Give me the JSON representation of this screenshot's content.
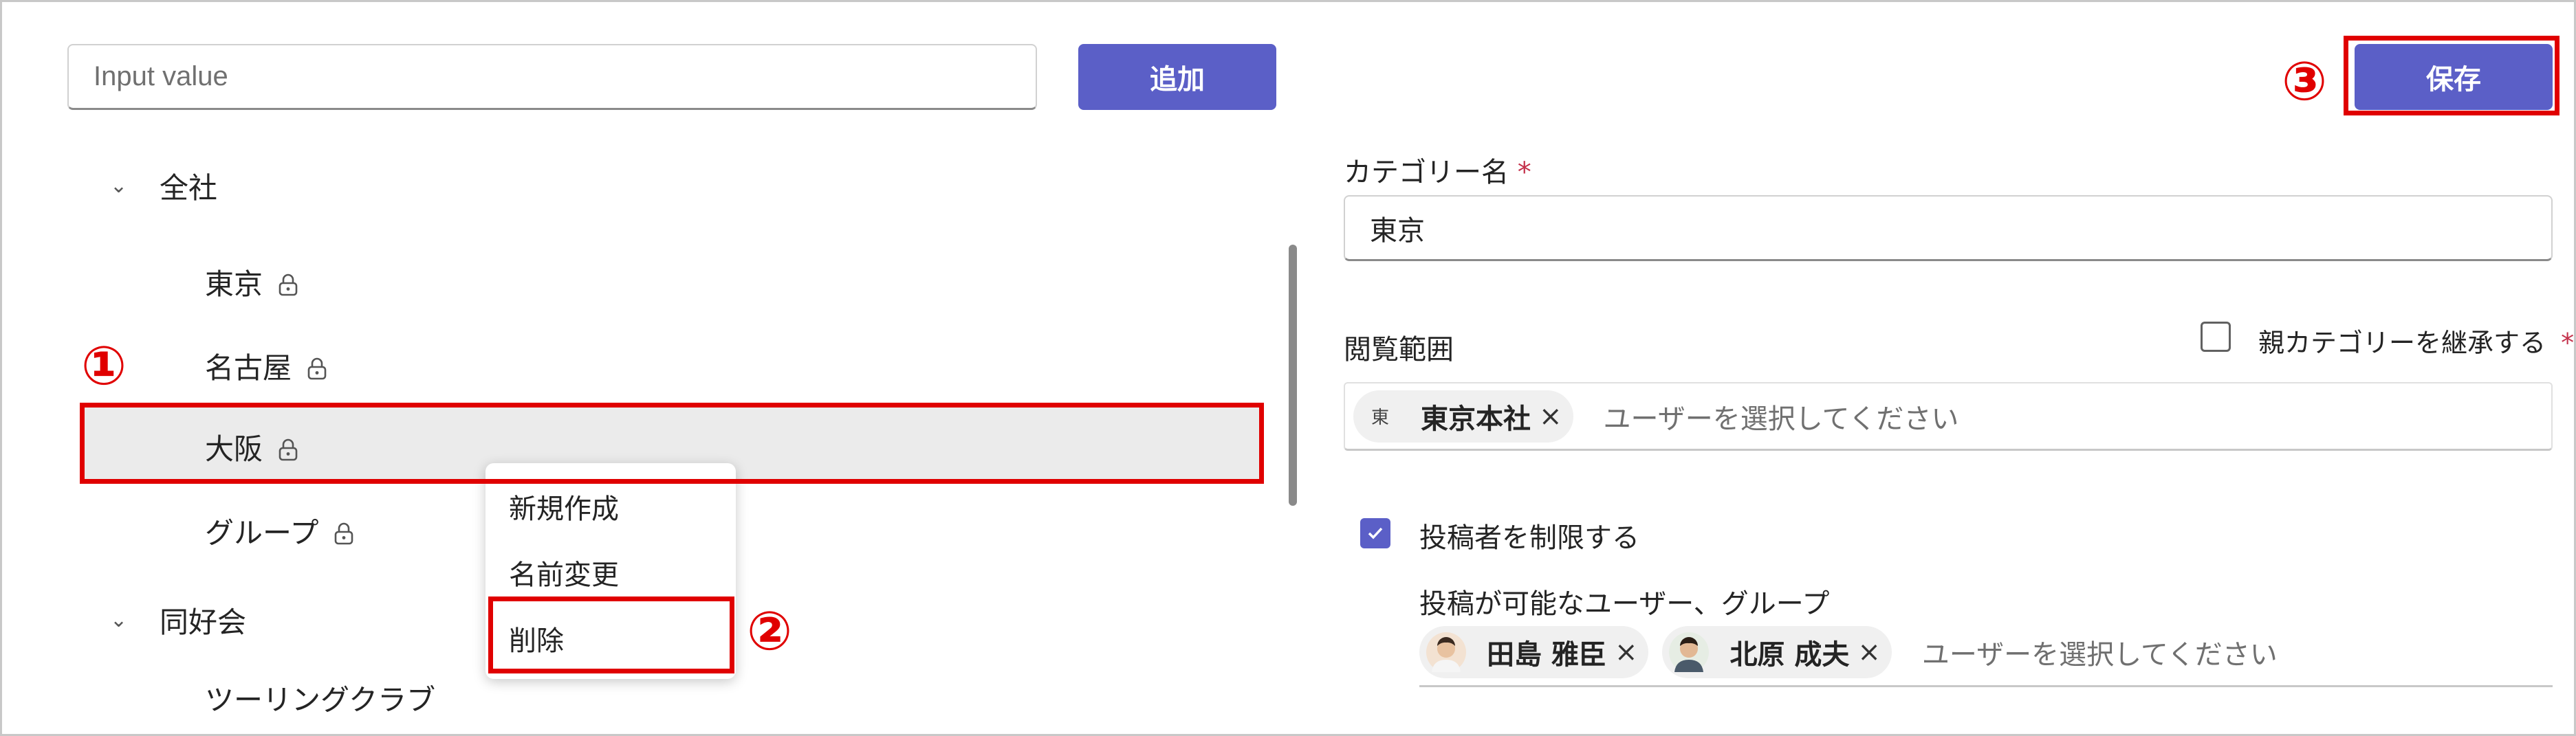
{
  "search": {
    "placeholder": "Input value"
  },
  "toolbar": {
    "add_label": "追加",
    "save_label": "保存"
  },
  "tree": {
    "groups": [
      {
        "label": "全社",
        "children": [
          "東京",
          "名古屋",
          "大阪",
          "グループ"
        ]
      },
      {
        "label": "同好会",
        "children": [
          "ツーリングクラブ"
        ]
      }
    ]
  },
  "context_menu": {
    "items": [
      "新規作成",
      "名前変更",
      "削除"
    ]
  },
  "annotations": {
    "step1": "①",
    "step2": "②",
    "step3": "③"
  },
  "form": {
    "category_label": "カテゴリー名",
    "required_mark": "*",
    "category_value": "東京",
    "view_scope_label": "閲覧範囲",
    "inherit_label": "親カテゴリーを継承する",
    "view_scope_chip": {
      "avatar": "東",
      "name": "東京本社"
    },
    "picker_placeholder": "ユーザーを選択してください",
    "restrict_label": "投稿者を制限する",
    "posters_label": "投稿が可能なユーザー、グループ",
    "poster_chips": [
      {
        "name": "田島 雅臣"
      },
      {
        "name": "北原 成夫"
      }
    ],
    "chip_remove": "×"
  },
  "colors": {
    "accent": "#5b5fc7",
    "highlight": "#e00000",
    "required": "#c4314b"
  }
}
